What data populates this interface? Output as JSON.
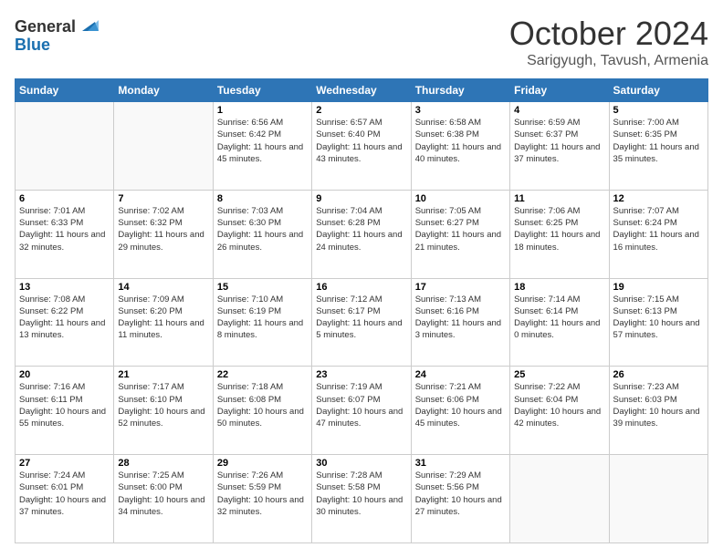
{
  "logo": {
    "general": "General",
    "blue": "Blue"
  },
  "header": {
    "month": "October 2024",
    "location": "Sarigyugh, Tavush, Armenia"
  },
  "days_of_week": [
    "Sunday",
    "Monday",
    "Tuesday",
    "Wednesday",
    "Thursday",
    "Friday",
    "Saturday"
  ],
  "weeks": [
    [
      {
        "day": "",
        "sunrise": "",
        "sunset": "",
        "daylight": ""
      },
      {
        "day": "",
        "sunrise": "",
        "sunset": "",
        "daylight": ""
      },
      {
        "day": "1",
        "sunrise": "Sunrise: 6:56 AM",
        "sunset": "Sunset: 6:42 PM",
        "daylight": "Daylight: 11 hours and 45 minutes."
      },
      {
        "day": "2",
        "sunrise": "Sunrise: 6:57 AM",
        "sunset": "Sunset: 6:40 PM",
        "daylight": "Daylight: 11 hours and 43 minutes."
      },
      {
        "day": "3",
        "sunrise": "Sunrise: 6:58 AM",
        "sunset": "Sunset: 6:38 PM",
        "daylight": "Daylight: 11 hours and 40 minutes."
      },
      {
        "day": "4",
        "sunrise": "Sunrise: 6:59 AM",
        "sunset": "Sunset: 6:37 PM",
        "daylight": "Daylight: 11 hours and 37 minutes."
      },
      {
        "day": "5",
        "sunrise": "Sunrise: 7:00 AM",
        "sunset": "Sunset: 6:35 PM",
        "daylight": "Daylight: 11 hours and 35 minutes."
      }
    ],
    [
      {
        "day": "6",
        "sunrise": "Sunrise: 7:01 AM",
        "sunset": "Sunset: 6:33 PM",
        "daylight": "Daylight: 11 hours and 32 minutes."
      },
      {
        "day": "7",
        "sunrise": "Sunrise: 7:02 AM",
        "sunset": "Sunset: 6:32 PM",
        "daylight": "Daylight: 11 hours and 29 minutes."
      },
      {
        "day": "8",
        "sunrise": "Sunrise: 7:03 AM",
        "sunset": "Sunset: 6:30 PM",
        "daylight": "Daylight: 11 hours and 26 minutes."
      },
      {
        "day": "9",
        "sunrise": "Sunrise: 7:04 AM",
        "sunset": "Sunset: 6:28 PM",
        "daylight": "Daylight: 11 hours and 24 minutes."
      },
      {
        "day": "10",
        "sunrise": "Sunrise: 7:05 AM",
        "sunset": "Sunset: 6:27 PM",
        "daylight": "Daylight: 11 hours and 21 minutes."
      },
      {
        "day": "11",
        "sunrise": "Sunrise: 7:06 AM",
        "sunset": "Sunset: 6:25 PM",
        "daylight": "Daylight: 11 hours and 18 minutes."
      },
      {
        "day": "12",
        "sunrise": "Sunrise: 7:07 AM",
        "sunset": "Sunset: 6:24 PM",
        "daylight": "Daylight: 11 hours and 16 minutes."
      }
    ],
    [
      {
        "day": "13",
        "sunrise": "Sunrise: 7:08 AM",
        "sunset": "Sunset: 6:22 PM",
        "daylight": "Daylight: 11 hours and 13 minutes."
      },
      {
        "day": "14",
        "sunrise": "Sunrise: 7:09 AM",
        "sunset": "Sunset: 6:20 PM",
        "daylight": "Daylight: 11 hours and 11 minutes."
      },
      {
        "day": "15",
        "sunrise": "Sunrise: 7:10 AM",
        "sunset": "Sunset: 6:19 PM",
        "daylight": "Daylight: 11 hours and 8 minutes."
      },
      {
        "day": "16",
        "sunrise": "Sunrise: 7:12 AM",
        "sunset": "Sunset: 6:17 PM",
        "daylight": "Daylight: 11 hours and 5 minutes."
      },
      {
        "day": "17",
        "sunrise": "Sunrise: 7:13 AM",
        "sunset": "Sunset: 6:16 PM",
        "daylight": "Daylight: 11 hours and 3 minutes."
      },
      {
        "day": "18",
        "sunrise": "Sunrise: 7:14 AM",
        "sunset": "Sunset: 6:14 PM",
        "daylight": "Daylight: 11 hours and 0 minutes."
      },
      {
        "day": "19",
        "sunrise": "Sunrise: 7:15 AM",
        "sunset": "Sunset: 6:13 PM",
        "daylight": "Daylight: 10 hours and 57 minutes."
      }
    ],
    [
      {
        "day": "20",
        "sunrise": "Sunrise: 7:16 AM",
        "sunset": "Sunset: 6:11 PM",
        "daylight": "Daylight: 10 hours and 55 minutes."
      },
      {
        "day": "21",
        "sunrise": "Sunrise: 7:17 AM",
        "sunset": "Sunset: 6:10 PM",
        "daylight": "Daylight: 10 hours and 52 minutes."
      },
      {
        "day": "22",
        "sunrise": "Sunrise: 7:18 AM",
        "sunset": "Sunset: 6:08 PM",
        "daylight": "Daylight: 10 hours and 50 minutes."
      },
      {
        "day": "23",
        "sunrise": "Sunrise: 7:19 AM",
        "sunset": "Sunset: 6:07 PM",
        "daylight": "Daylight: 10 hours and 47 minutes."
      },
      {
        "day": "24",
        "sunrise": "Sunrise: 7:21 AM",
        "sunset": "Sunset: 6:06 PM",
        "daylight": "Daylight: 10 hours and 45 minutes."
      },
      {
        "day": "25",
        "sunrise": "Sunrise: 7:22 AM",
        "sunset": "Sunset: 6:04 PM",
        "daylight": "Daylight: 10 hours and 42 minutes."
      },
      {
        "day": "26",
        "sunrise": "Sunrise: 7:23 AM",
        "sunset": "Sunset: 6:03 PM",
        "daylight": "Daylight: 10 hours and 39 minutes."
      }
    ],
    [
      {
        "day": "27",
        "sunrise": "Sunrise: 7:24 AM",
        "sunset": "Sunset: 6:01 PM",
        "daylight": "Daylight: 10 hours and 37 minutes."
      },
      {
        "day": "28",
        "sunrise": "Sunrise: 7:25 AM",
        "sunset": "Sunset: 6:00 PM",
        "daylight": "Daylight: 10 hours and 34 minutes."
      },
      {
        "day": "29",
        "sunrise": "Sunrise: 7:26 AM",
        "sunset": "Sunset: 5:59 PM",
        "daylight": "Daylight: 10 hours and 32 minutes."
      },
      {
        "day": "30",
        "sunrise": "Sunrise: 7:28 AM",
        "sunset": "Sunset: 5:58 PM",
        "daylight": "Daylight: 10 hours and 30 minutes."
      },
      {
        "day": "31",
        "sunrise": "Sunrise: 7:29 AM",
        "sunset": "Sunset: 5:56 PM",
        "daylight": "Daylight: 10 hours and 27 minutes."
      },
      {
        "day": "",
        "sunrise": "",
        "sunset": "",
        "daylight": ""
      },
      {
        "day": "",
        "sunrise": "",
        "sunset": "",
        "daylight": ""
      }
    ]
  ]
}
